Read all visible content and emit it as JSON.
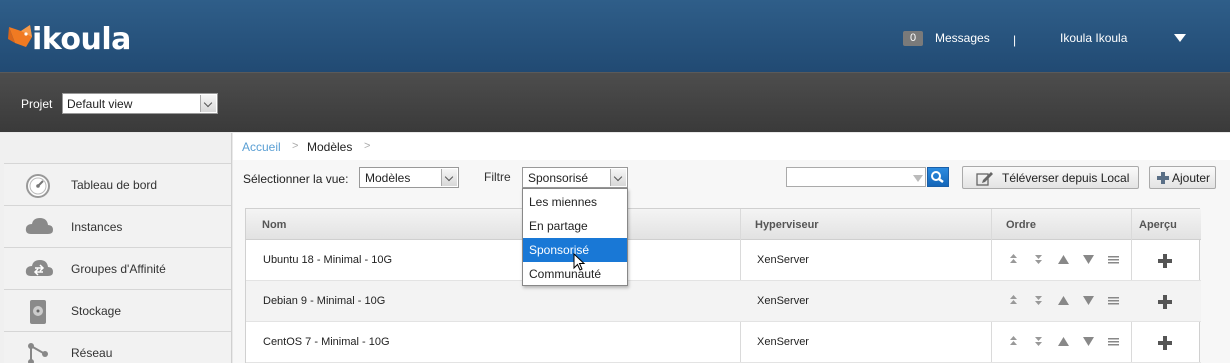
{
  "header": {
    "brand": "ikoula",
    "messages_count": "0",
    "messages_label": "Messages",
    "separator": "|",
    "user_name": "Ikoula Ikoula"
  },
  "project": {
    "label": "Projet",
    "selected": "Default view"
  },
  "sidebar": {
    "items": [
      {
        "label": "Tableau de bord",
        "icon": "dashboard-icon"
      },
      {
        "label": "Instances",
        "icon": "cloud-icon"
      },
      {
        "label": "Groupes d'Affinité",
        "icon": "affinity-cloud-icon"
      },
      {
        "label": "Stockage",
        "icon": "disk-icon"
      },
      {
        "label": "Réseau",
        "icon": "network-icon"
      }
    ]
  },
  "breadcrumb": {
    "home": "Accueil",
    "sep": ">",
    "current": "Modèles"
  },
  "toolbar": {
    "view_label": "Sélectionner la vue:",
    "view_selected": "Modèles",
    "filter_label": "Filtre",
    "filter_selected": "Sponsorisé",
    "upload_label": "Téléverser depuis Local",
    "add_label": "Ajouter"
  },
  "filter_options": [
    "Les miennes",
    "En partage",
    "Sponsorisé",
    "Communauté"
  ],
  "table": {
    "headers": [
      "Nom",
      "Hyperviseur",
      "Ordre",
      "Aperçu"
    ],
    "rows": [
      {
        "name": "Ubuntu 18 - Minimal - 10G",
        "hypervisor": "XenServer"
      },
      {
        "name": "Debian 9 - Minimal - 10G",
        "hypervisor": "XenServer"
      },
      {
        "name": "CentOS 7 - Minimal - 10G",
        "hypervisor": "XenServer"
      }
    ]
  },
  "colors": {
    "header_blue": "#2f5e89",
    "project_bar": "#444444",
    "accent": "#1978d6",
    "brand_orange": "#f07a22"
  }
}
